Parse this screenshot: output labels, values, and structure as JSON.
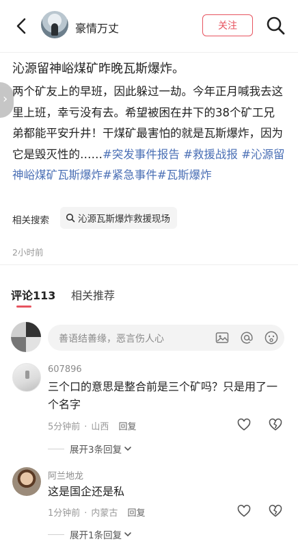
{
  "header": {
    "author": "豪情万丈",
    "follow_label": "关注"
  },
  "post": {
    "title": "沁源留神峪煤矿昨晚瓦斯爆炸。",
    "body": "两个矿友上的早班，因此躲过一劫。今年正月喊我去这里上班，幸亏没有去。希望被困在井下的38个矿工兄弟都能平安升井！干煤矿最害怕的就是瓦斯爆炸，因为它是毁灭性的……",
    "tags": [
      "#突发事件报告",
      "#救援战报",
      "#沁源留神峪煤矿瓦斯爆炸",
      "#紧急事件",
      "#瓦斯爆炸"
    ],
    "related_label": "相关搜索",
    "related_query": "沁源瓦斯爆炸救援现场",
    "time": "2小时前"
  },
  "tabs": {
    "comments": "评论113",
    "related": "相关推荐"
  },
  "comment_input": {
    "placeholder": "善语结善缘，恶言伤人心"
  },
  "comments": [
    {
      "user": "607896",
      "text": "三个口的意思是整合前是三个矿吗？只是用了一个名字",
      "time": "5分钟前",
      "location": "山西",
      "reply_label": "回复",
      "expand": "展开3条回复"
    },
    {
      "user": "阿兰地龙",
      "text": "这是国企还是私",
      "time": "1分钟前",
      "location": "内蒙古",
      "reply_label": "回复",
      "expand": "展开1条回复"
    }
  ],
  "colors": {
    "accent": "#e7535f",
    "tag": "#4a6fb5"
  },
  "icons": [
    "back-icon",
    "search-icon",
    "magnifier-icon",
    "image-icon",
    "at-icon",
    "emoji-icon",
    "heart-icon",
    "broken-heart-icon",
    "chevron-down-icon"
  ]
}
